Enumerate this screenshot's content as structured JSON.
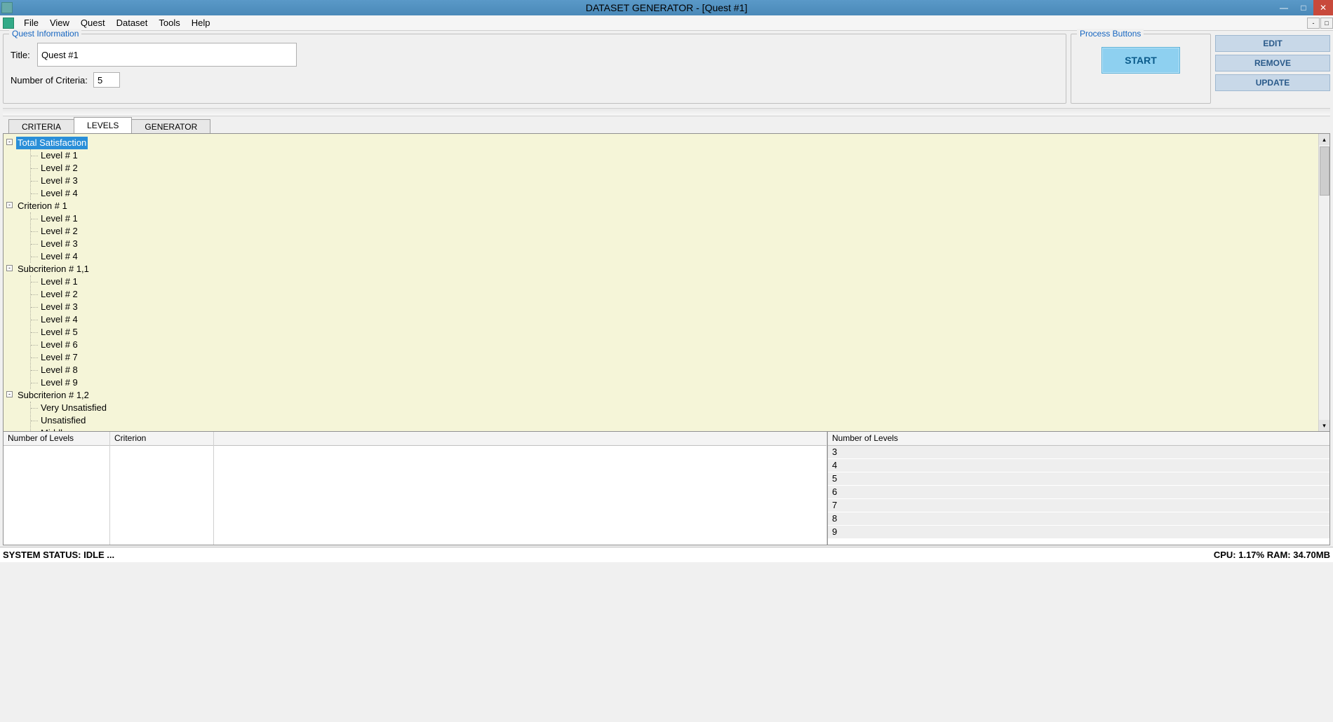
{
  "window": {
    "title": "DATASET GENERATOR - [Quest #1]"
  },
  "menu": {
    "items": [
      "File",
      "View",
      "Quest",
      "Dataset",
      "Tools",
      "Help"
    ]
  },
  "quest_info": {
    "legend": "Quest Information",
    "title_label": "Title:",
    "title_value": "Quest #1",
    "num_label": "Number of Criteria:",
    "num_value": "5"
  },
  "process": {
    "legend": "Process Buttons",
    "start": "START"
  },
  "right_buttons": {
    "edit": "EDIT",
    "remove": "REMOVE",
    "update": "UPDATE"
  },
  "tabs": {
    "criteria": "CRITERIA",
    "levels": "LEVELS",
    "generator": "GENERATOR"
  },
  "tree": [
    {
      "label": "Total Satisfaction",
      "selected": true,
      "children": [
        "Level # 1",
        "Level # 2",
        "Level # 3",
        "Level # 4"
      ]
    },
    {
      "label": "Criterion # 1",
      "children": [
        "Level # 1",
        "Level # 2",
        "Level # 3",
        "Level # 4"
      ]
    },
    {
      "label": "Subcriterion # 1,1",
      "children": [
        "Level # 1",
        "Level # 2",
        "Level # 3",
        "Level # 4",
        "Level # 5",
        "Level # 6",
        "Level # 7",
        "Level # 8",
        "Level # 9"
      ]
    },
    {
      "label": "Subcriterion # 1,2",
      "children": [
        "Very Unsatisfied",
        "Unsatisfied",
        "Middle"
      ]
    }
  ],
  "grid_left": {
    "col_levels": "Number of Levels",
    "col_criterion": "Criterion"
  },
  "grid_right": {
    "header": "Number of Levels",
    "rows": [
      "3",
      "4",
      "5",
      "6",
      "7",
      "8",
      "9"
    ]
  },
  "status": {
    "left": "SYSTEM STATUS: IDLE ...",
    "right": "CPU: 1.17% RAM: 34.70MB"
  }
}
